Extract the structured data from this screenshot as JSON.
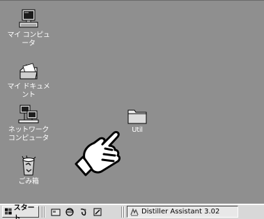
{
  "desktop": {
    "icons": [
      {
        "label": "マイ コンピュータ",
        "icon": "my-computer-icon"
      },
      {
        "label": "マイ ドキュメント",
        "icon": "my-documents-icon"
      },
      {
        "label": "ネットワーク\nコンピュータ",
        "icon": "network-computer-icon"
      },
      {
        "label": "ごみ箱",
        "icon": "recycle-bin-icon"
      },
      {
        "label": "Util",
        "icon": "folder-icon"
      }
    ],
    "pointer": "hand-pointer-icon"
  },
  "taskbar": {
    "start_label": "スタート",
    "quick_launch": [
      "show-desktop-icon",
      "internet-explorer-icon",
      "outlook-express-icon",
      "channels-icon"
    ],
    "tasks": [
      {
        "label": "Distiller Assistant 3.02",
        "icon": "distiller-icon"
      }
    ]
  }
}
